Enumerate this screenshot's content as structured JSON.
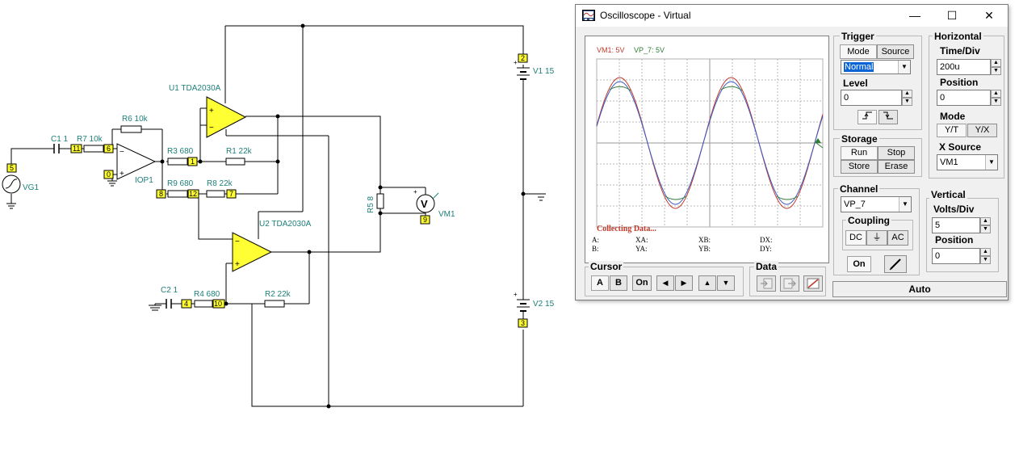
{
  "schematic": {
    "labels": {
      "u1": "U1 TDA2030A",
      "u2": "U2 TDA2030A",
      "r6": "R6 10k",
      "c1": "C1 1",
      "r7": "R7 10k",
      "r3": "R3 680",
      "r1": "R1 22k",
      "r9": "R9 680",
      "r8": "R8 22k",
      "iop": "IOP1",
      "vg": "VG1",
      "r5": "R5 8",
      "vm1": "VM1",
      "v1": "V1 15",
      "v2": "V2 15",
      "c2": "C2 1",
      "r4": "R4 680",
      "r2": "R2 22k",
      "vmsym": "V"
    },
    "nodes": {
      "n11": "11",
      "n6": "6",
      "n0": "0",
      "n5": "5",
      "n1": "1",
      "n8": "8",
      "n12": "12",
      "n7": "7",
      "n9": "9",
      "n2": "2",
      "n3": "3",
      "n4": "4",
      "n10": "10"
    }
  },
  "osc": {
    "title": "Oscilloscope - Virtual",
    "window_buttons": {
      "minimize": "—",
      "maximize": "☐",
      "close": "✕"
    },
    "screen": {
      "ch1_label": "VM1: 5V",
      "ch2_label": "VP_7: 5V",
      "ch1_color": "#c0392b",
      "ch2_color": "#2e7d32",
      "status": "Collecting Data...",
      "readouts": {
        "a": "A:",
        "b": "B:",
        "xa": "XA:",
        "ya": "YA:",
        "xb": "XB:",
        "yb": "YB:",
        "dx": "DX:",
        "dy": "DY:"
      }
    },
    "trigger": {
      "title": "Trigger",
      "mode": "Mode",
      "source": "Source",
      "selected": "Normal",
      "level_label": "Level",
      "level": "0"
    },
    "storage": {
      "title": "Storage",
      "run": "Run",
      "stop": "Stop",
      "store": "Store",
      "erase": "Erase"
    },
    "horizontal": {
      "title": "Horizontal",
      "time_div_label": "Time/Div",
      "time_div": "200u",
      "position_label": "Position",
      "position": "0",
      "mode_label": "Mode",
      "yt": "Y/T",
      "yx": "Y/X",
      "xsource_label": "X Source",
      "xsource": "VM1"
    },
    "channel": {
      "title": "Channel",
      "selected": "VP_7",
      "coupling_label": "Coupling",
      "dc": "DC",
      "gnd": "⏚",
      "ac": "AC",
      "on": "On"
    },
    "vertical": {
      "title": "Vertical",
      "volts_div_label": "Volts/Div",
      "volts_div": "5",
      "position_label": "Position",
      "position": "0"
    },
    "cursor": {
      "title": "Cursor",
      "a": "A",
      "b": "B",
      "on": "On"
    },
    "data": {
      "title": "Data"
    },
    "auto": "Auto"
  }
}
